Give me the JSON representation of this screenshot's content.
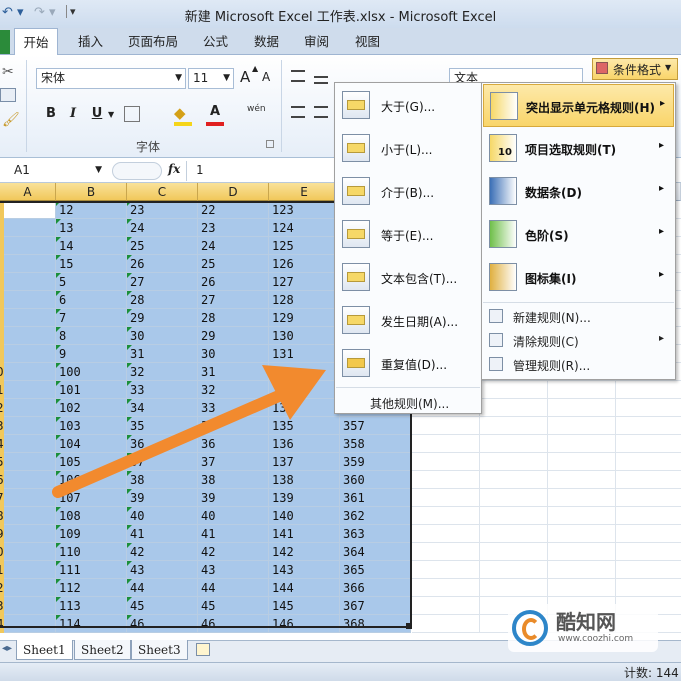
{
  "window_title": "新建 Microsoft Excel 工作表.xlsx - Microsoft Excel",
  "qat": {
    "undo_icon": "↶ ▾",
    "redo_icon": "↷ ▾",
    "menu_icon": "▾"
  },
  "tabs": [
    "开始",
    "插入",
    "页面布局",
    "公式",
    "数据",
    "审阅",
    "视图"
  ],
  "ribbon": {
    "font_name": "宋体",
    "font_size": "11",
    "grow_font": "A",
    "shrink_font": "A",
    "bold": "B",
    "italic": "I",
    "underline": "U",
    "font_color_letter": "A",
    "wen": "wén",
    "font_group_label": "字体",
    "number_format": "文本",
    "cond_format_label": "条件格式"
  },
  "namebox": "A1",
  "fx": "fx",
  "formula_value": "1",
  "columns": [
    "A",
    "B",
    "C",
    "D",
    "E"
  ],
  "rows": [
    [
      "12",
      "23",
      "22",
      "123"
    ],
    [
      "13",
      "24",
      "23",
      "124"
    ],
    [
      "14",
      "25",
      "24",
      "125"
    ],
    [
      "15",
      "26",
      "25",
      "126"
    ],
    [
      "5",
      "27",
      "26",
      "127"
    ],
    [
      "6",
      "28",
      "27",
      "128"
    ],
    [
      "7",
      "29",
      "28",
      "129"
    ],
    [
      "8",
      "30",
      "29",
      "130"
    ],
    [
      "9",
      "31",
      "30",
      "131"
    ],
    [
      "100",
      "32",
      "31",
      ""
    ],
    [
      "101",
      "33",
      "32",
      ""
    ],
    [
      "102",
      "34",
      "33",
      "134"
    ],
    [
      "103",
      "35",
      "34",
      "135",
      "357"
    ],
    [
      "104",
      "36",
      "36",
      "136",
      "358"
    ],
    [
      "105",
      "37",
      "37",
      "137",
      "359"
    ],
    [
      "106",
      "38",
      "38",
      "138",
      "360"
    ],
    [
      "107",
      "39",
      "39",
      "139",
      "361"
    ],
    [
      "108",
      "40",
      "40",
      "140",
      "362"
    ],
    [
      "109",
      "41",
      "41",
      "141",
      "363"
    ],
    [
      "110",
      "42",
      "42",
      "142",
      "364"
    ],
    [
      "111",
      "43",
      "43",
      "143",
      "365"
    ],
    [
      "112",
      "44",
      "44",
      "144",
      "366"
    ],
    [
      "113",
      "45",
      "45",
      "145",
      "367"
    ],
    [
      "114",
      "46",
      "46",
      "146",
      "368"
    ]
  ],
  "row_header_fragments": [
    "",
    "",
    "",
    "",
    "",
    "",
    "",
    "",
    "",
    "0",
    "1",
    "2",
    "3",
    "4",
    "5",
    "6",
    "7",
    "8",
    "9",
    "0",
    "1",
    "2",
    "3",
    "4"
  ],
  "submenu": {
    "items": [
      "大于(G)...",
      "小于(L)...",
      "介于(B)...",
      "等于(E)...",
      "文本包含(T)...",
      "发生日期(A)...",
      "重复值(D)..."
    ],
    "other": "其他规则(M)..."
  },
  "cf_menu": {
    "items": [
      "突出显示单元格规则(H)",
      "项目选取规则(T)",
      "数据条(D)",
      "色阶(S)",
      "图标集(I)"
    ],
    "small": [
      "新建规则(N)...",
      "清除规则(C)",
      "管理规则(R)..."
    ],
    "icon_badges": [
      "",
      "10",
      "",
      "",
      ""
    ],
    "arrow": "▸"
  },
  "sheets": [
    "Sheet1",
    "Sheet2",
    "Sheet3"
  ],
  "status": "计数: 144",
  "watermark": {
    "brand": "酷知网",
    "url": "www.coozhi.com"
  },
  "colors": {
    "accent_orange": "#f28a2e",
    "selection": "#a9c8ea",
    "header_gold": "#f1c85b"
  }
}
